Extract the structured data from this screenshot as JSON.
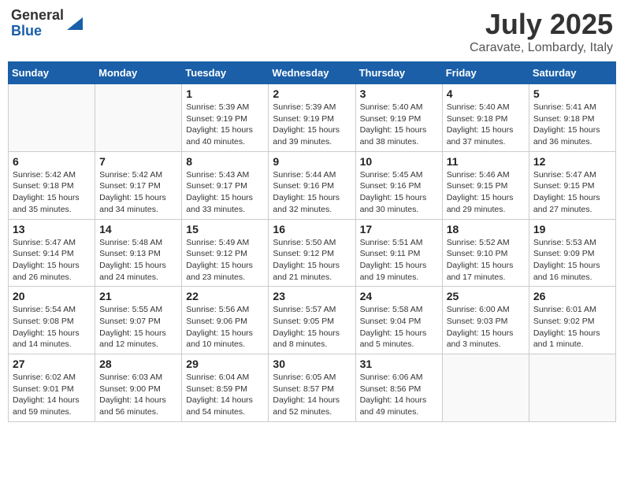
{
  "logo": {
    "general": "General",
    "blue": "Blue"
  },
  "title": "July 2025",
  "location": "Caravate, Lombardy, Italy",
  "weekdays": [
    "Sunday",
    "Monday",
    "Tuesday",
    "Wednesday",
    "Thursday",
    "Friday",
    "Saturday"
  ],
  "weeks": [
    [
      {
        "day": "",
        "info": ""
      },
      {
        "day": "",
        "info": ""
      },
      {
        "day": "1",
        "info": "Sunrise: 5:39 AM\nSunset: 9:19 PM\nDaylight: 15 hours\nand 40 minutes."
      },
      {
        "day": "2",
        "info": "Sunrise: 5:39 AM\nSunset: 9:19 PM\nDaylight: 15 hours\nand 39 minutes."
      },
      {
        "day": "3",
        "info": "Sunrise: 5:40 AM\nSunset: 9:19 PM\nDaylight: 15 hours\nand 38 minutes."
      },
      {
        "day": "4",
        "info": "Sunrise: 5:40 AM\nSunset: 9:18 PM\nDaylight: 15 hours\nand 37 minutes."
      },
      {
        "day": "5",
        "info": "Sunrise: 5:41 AM\nSunset: 9:18 PM\nDaylight: 15 hours\nand 36 minutes."
      }
    ],
    [
      {
        "day": "6",
        "info": "Sunrise: 5:42 AM\nSunset: 9:18 PM\nDaylight: 15 hours\nand 35 minutes."
      },
      {
        "day": "7",
        "info": "Sunrise: 5:42 AM\nSunset: 9:17 PM\nDaylight: 15 hours\nand 34 minutes."
      },
      {
        "day": "8",
        "info": "Sunrise: 5:43 AM\nSunset: 9:17 PM\nDaylight: 15 hours\nand 33 minutes."
      },
      {
        "day": "9",
        "info": "Sunrise: 5:44 AM\nSunset: 9:16 PM\nDaylight: 15 hours\nand 32 minutes."
      },
      {
        "day": "10",
        "info": "Sunrise: 5:45 AM\nSunset: 9:16 PM\nDaylight: 15 hours\nand 30 minutes."
      },
      {
        "day": "11",
        "info": "Sunrise: 5:46 AM\nSunset: 9:15 PM\nDaylight: 15 hours\nand 29 minutes."
      },
      {
        "day": "12",
        "info": "Sunrise: 5:47 AM\nSunset: 9:15 PM\nDaylight: 15 hours\nand 27 minutes."
      }
    ],
    [
      {
        "day": "13",
        "info": "Sunrise: 5:47 AM\nSunset: 9:14 PM\nDaylight: 15 hours\nand 26 minutes."
      },
      {
        "day": "14",
        "info": "Sunrise: 5:48 AM\nSunset: 9:13 PM\nDaylight: 15 hours\nand 24 minutes."
      },
      {
        "day": "15",
        "info": "Sunrise: 5:49 AM\nSunset: 9:12 PM\nDaylight: 15 hours\nand 23 minutes."
      },
      {
        "day": "16",
        "info": "Sunrise: 5:50 AM\nSunset: 9:12 PM\nDaylight: 15 hours\nand 21 minutes."
      },
      {
        "day": "17",
        "info": "Sunrise: 5:51 AM\nSunset: 9:11 PM\nDaylight: 15 hours\nand 19 minutes."
      },
      {
        "day": "18",
        "info": "Sunrise: 5:52 AM\nSunset: 9:10 PM\nDaylight: 15 hours\nand 17 minutes."
      },
      {
        "day": "19",
        "info": "Sunrise: 5:53 AM\nSunset: 9:09 PM\nDaylight: 15 hours\nand 16 minutes."
      }
    ],
    [
      {
        "day": "20",
        "info": "Sunrise: 5:54 AM\nSunset: 9:08 PM\nDaylight: 15 hours\nand 14 minutes."
      },
      {
        "day": "21",
        "info": "Sunrise: 5:55 AM\nSunset: 9:07 PM\nDaylight: 15 hours\nand 12 minutes."
      },
      {
        "day": "22",
        "info": "Sunrise: 5:56 AM\nSunset: 9:06 PM\nDaylight: 15 hours\nand 10 minutes."
      },
      {
        "day": "23",
        "info": "Sunrise: 5:57 AM\nSunset: 9:05 PM\nDaylight: 15 hours\nand 8 minutes."
      },
      {
        "day": "24",
        "info": "Sunrise: 5:58 AM\nSunset: 9:04 PM\nDaylight: 15 hours\nand 5 minutes."
      },
      {
        "day": "25",
        "info": "Sunrise: 6:00 AM\nSunset: 9:03 PM\nDaylight: 15 hours\nand 3 minutes."
      },
      {
        "day": "26",
        "info": "Sunrise: 6:01 AM\nSunset: 9:02 PM\nDaylight: 15 hours\nand 1 minute."
      }
    ],
    [
      {
        "day": "27",
        "info": "Sunrise: 6:02 AM\nSunset: 9:01 PM\nDaylight: 14 hours\nand 59 minutes."
      },
      {
        "day": "28",
        "info": "Sunrise: 6:03 AM\nSunset: 9:00 PM\nDaylight: 14 hours\nand 56 minutes."
      },
      {
        "day": "29",
        "info": "Sunrise: 6:04 AM\nSunset: 8:59 PM\nDaylight: 14 hours\nand 54 minutes."
      },
      {
        "day": "30",
        "info": "Sunrise: 6:05 AM\nSunset: 8:57 PM\nDaylight: 14 hours\nand 52 minutes."
      },
      {
        "day": "31",
        "info": "Sunrise: 6:06 AM\nSunset: 8:56 PM\nDaylight: 14 hours\nand 49 minutes."
      },
      {
        "day": "",
        "info": ""
      },
      {
        "day": "",
        "info": ""
      }
    ]
  ]
}
